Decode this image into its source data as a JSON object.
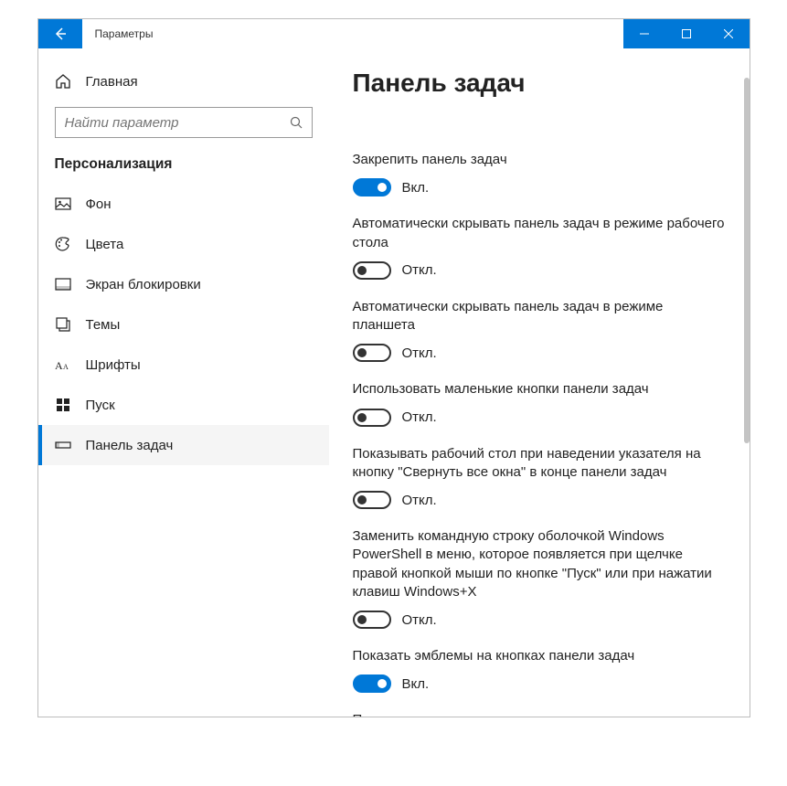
{
  "title": "Параметры",
  "home_label": "Главная",
  "search": {
    "placeholder": "Найти параметр"
  },
  "category_label": "Персонализация",
  "nav": [
    {
      "label": "Фон",
      "icon": "picture-icon"
    },
    {
      "label": "Цвета",
      "icon": "palette-icon"
    },
    {
      "label": "Экран блокировки",
      "icon": "lockscreen-icon"
    },
    {
      "label": "Темы",
      "icon": "themes-icon"
    },
    {
      "label": "Шрифты",
      "icon": "fonts-icon"
    },
    {
      "label": "Пуск",
      "icon": "start-icon"
    },
    {
      "label": "Панель задач",
      "icon": "taskbar-icon",
      "active": true
    }
  ],
  "page_heading": "Панель задач",
  "state_on": "Вкл.",
  "state_off": "Откл.",
  "settings": [
    {
      "label": "Закрепить панель задач",
      "on": true
    },
    {
      "label": "Автоматически скрывать панель задач в режиме рабочего стола",
      "on": false
    },
    {
      "label": "Автоматически скрывать панель задач в режиме планшета",
      "on": false
    },
    {
      "label": "Использовать маленькие кнопки панели задач",
      "on": false
    },
    {
      "label": "Показывать рабочий стол при наведении указателя на кнопку \"Свернуть все окна\" в конце панели задач",
      "on": false
    },
    {
      "label": "Заменить командную строку оболочкой Windows PowerShell в меню, которое появляется при щелчке правой кнопкой мыши по кнопке \"Пуск\" или при нажатии клавиш Windows+X",
      "on": false
    },
    {
      "label": "Показать эмблемы на кнопках панели задач",
      "on": true
    },
    {
      "label": "Положение панели задач на экране",
      "is_header": true
    }
  ],
  "colors": {
    "accent": "#0078d7"
  }
}
